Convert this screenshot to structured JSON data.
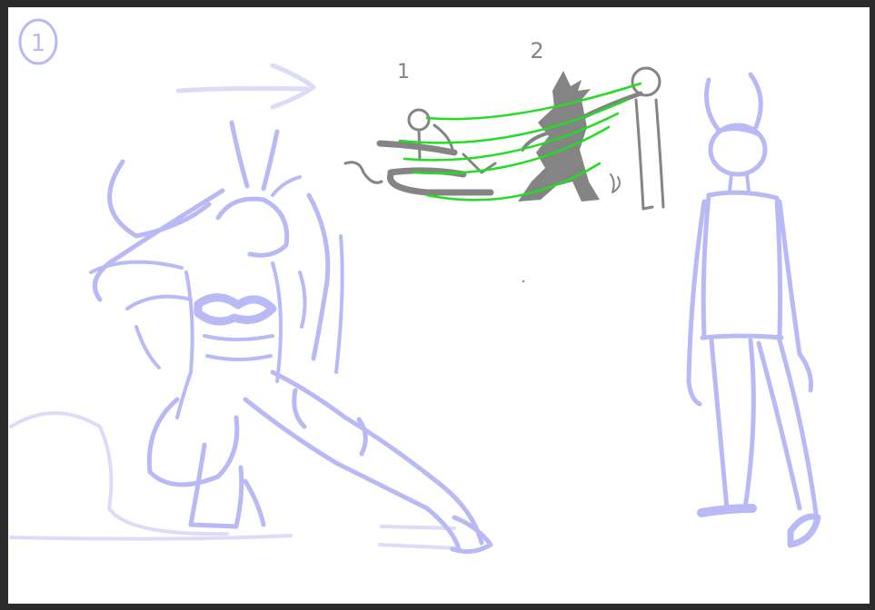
{
  "canvas": {
    "background": "#ffffff",
    "frame_color": "#2b2b2b"
  },
  "colors": {
    "sketch_lavender": "#b9b9f6",
    "sketch_light": "#dcdcfa",
    "thumbnail_grey": "#848484",
    "energy_green": "#22dd22"
  },
  "annotations": {
    "panel_number": "1",
    "figure_1_label": "1",
    "figure_2_label": "2"
  }
}
